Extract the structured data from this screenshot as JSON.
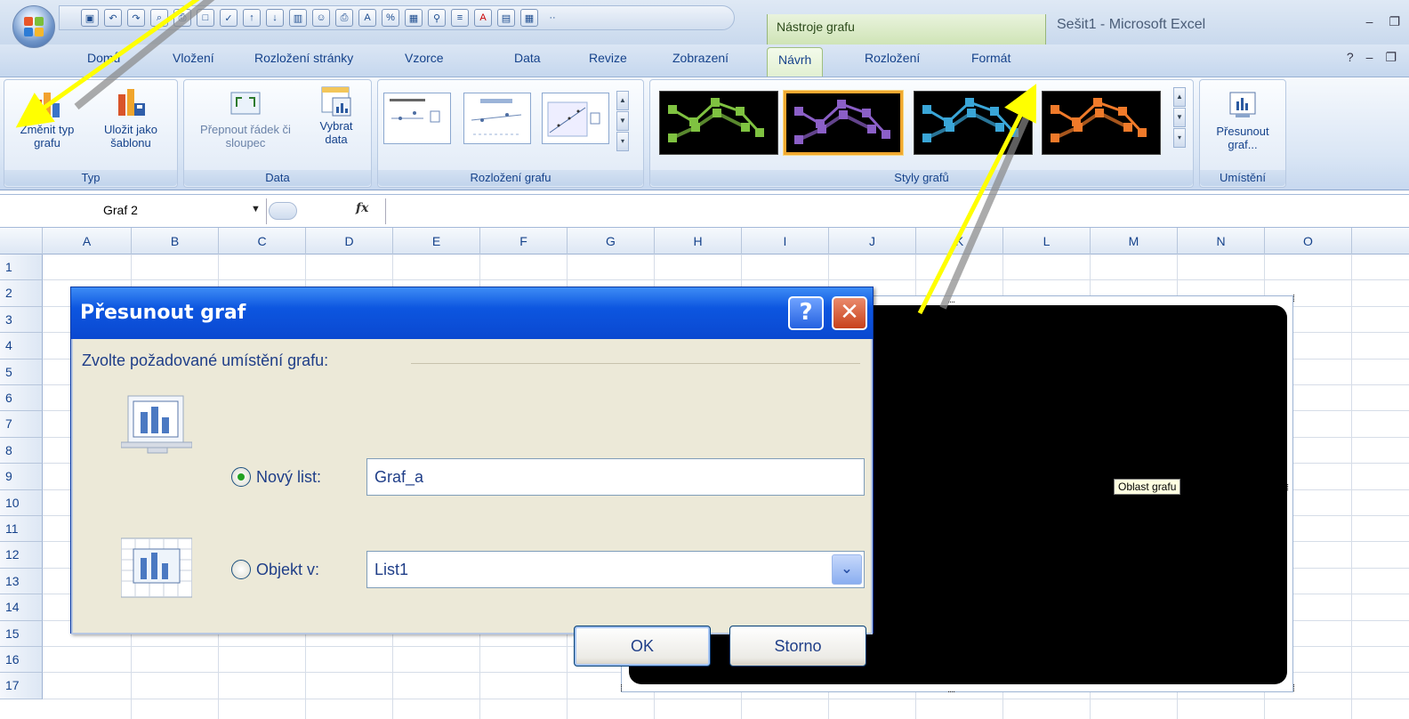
{
  "window": {
    "title": "Sešit1 - Microsoft Excel",
    "context_tab_group": "Nástroje grafu"
  },
  "tabs": [
    {
      "label": "Domů"
    },
    {
      "label": "Vložení"
    },
    {
      "label": "Rozložení stránky"
    },
    {
      "label": "Vzorce"
    },
    {
      "label": "Data"
    },
    {
      "label": "Revize"
    },
    {
      "label": "Zobrazení"
    },
    {
      "label": "Návrh"
    },
    {
      "label": "Rozložení"
    },
    {
      "label": "Formát"
    }
  ],
  "ribbon": {
    "groups": {
      "typ": "Typ",
      "data": "Data",
      "layout": "Rozložení grafu",
      "styles": "Styly grafů",
      "location": "Umístění"
    },
    "buttons": {
      "change_type": "Změnit typ grafu",
      "save_template": "Uložit jako šablonu",
      "switch_row": "Přepnout řádek či sloupec",
      "select_data": "Vybrat data",
      "move_chart": "Přesunout graf..."
    }
  },
  "formula_bar": {
    "name_box": "Graf 2",
    "fx": "fx"
  },
  "sheet": {
    "columns": [
      "A",
      "B",
      "C",
      "D",
      "E",
      "F",
      "G",
      "H",
      "I",
      "J",
      "K",
      "L",
      "M",
      "N",
      "O"
    ],
    "rows": [
      "1",
      "2",
      "3",
      "4",
      "5",
      "6",
      "7",
      "8",
      "9",
      "10",
      "11",
      "12",
      "13",
      "14",
      "15",
      "16",
      "17"
    ]
  },
  "chart": {
    "tooltip": "Oblast grafu",
    "handle_dots": "....",
    "background": "#000000"
  },
  "dialog": {
    "title": "Přesunout graf",
    "help": "?",
    "close": "✕",
    "group_label": "Zvolte požadované umístění grafu:",
    "new_sheet_label": "Nový list:",
    "new_sheet_value": "Graf_a",
    "new_sheet_selected": true,
    "object_label": "Objekt v:",
    "object_value": "List1",
    "ok": "OK",
    "cancel": "Storno"
  },
  "style_colors": [
    "#7fc241",
    "#8b5fc7",
    "#3aa6d8",
    "#f07a2a"
  ],
  "annotation_color": "#ffff00"
}
